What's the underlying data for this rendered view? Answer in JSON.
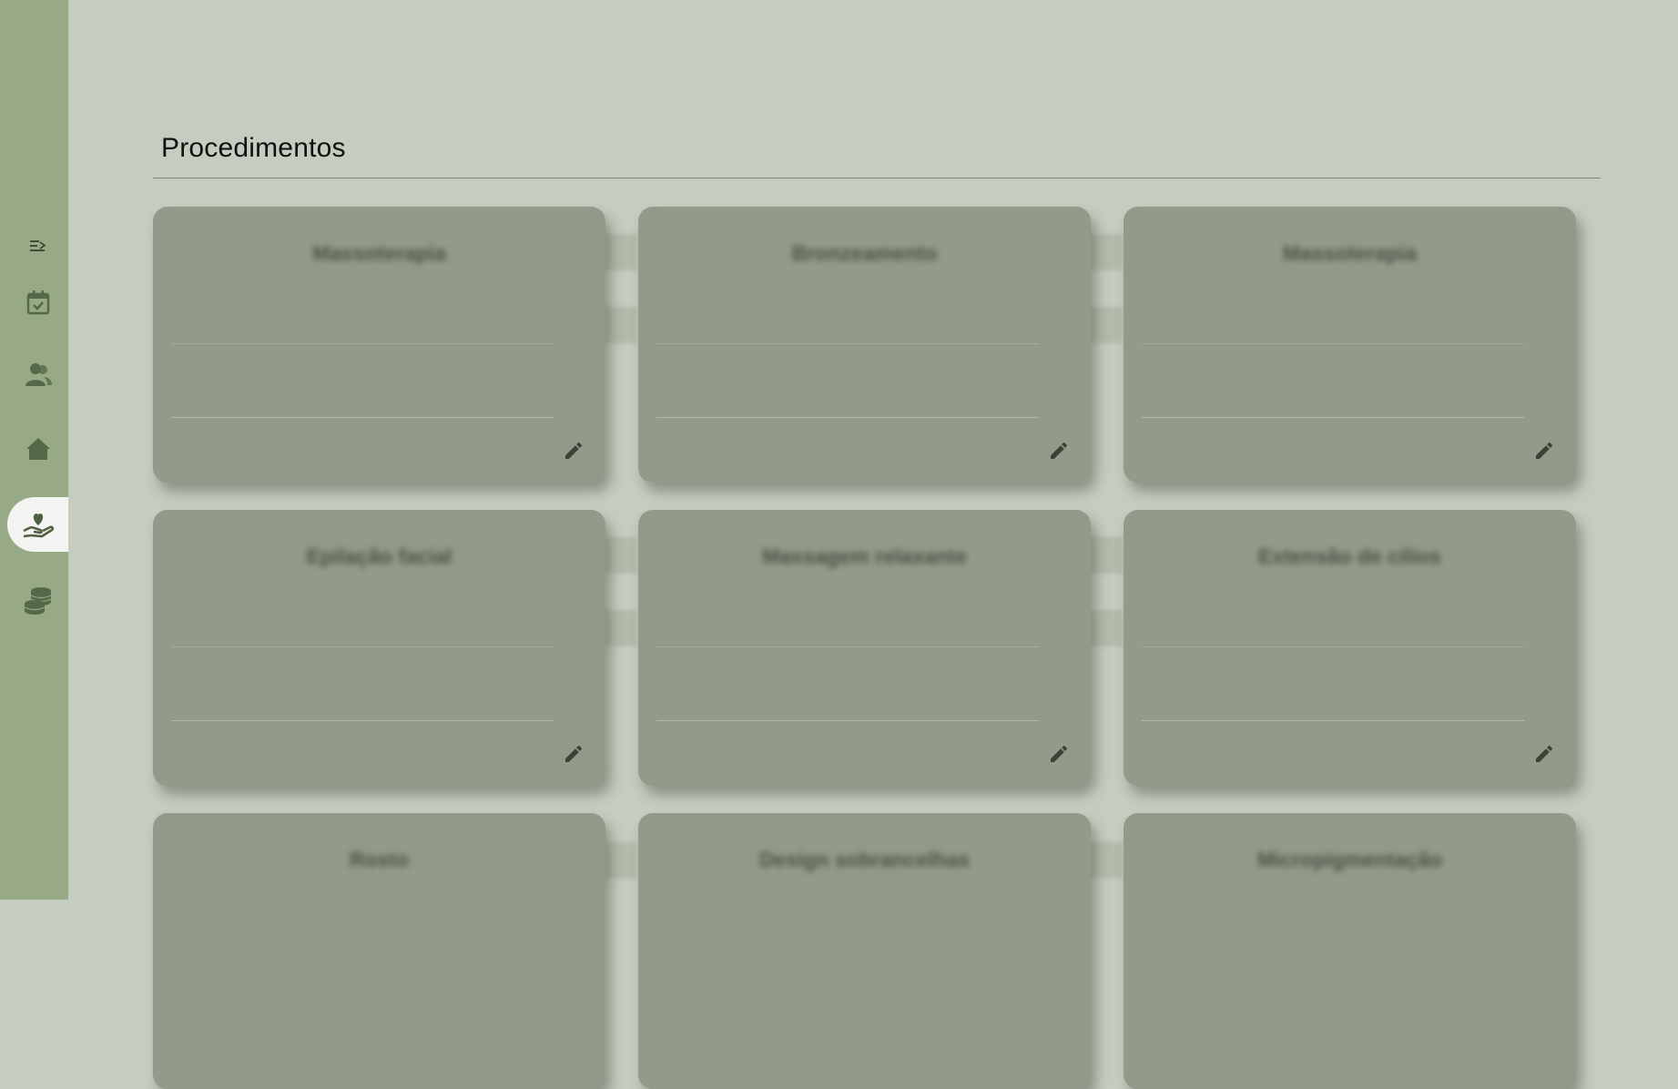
{
  "sidebar": {
    "items": [
      {
        "icon": "menu-collapse-icon",
        "active": false
      },
      {
        "icon": "calendar-check-icon",
        "active": false
      },
      {
        "icon": "users-icon",
        "active": false
      },
      {
        "icon": "home-icon",
        "active": false
      },
      {
        "icon": "hand-heart-icon",
        "active": true
      },
      {
        "icon": "coins-icon",
        "active": false
      }
    ]
  },
  "page": {
    "title": "Procedimentos"
  },
  "cards": [
    {
      "name": "Massoterapia"
    },
    {
      "name": "Bronzeamento"
    },
    {
      "name": "Massoterapia"
    },
    {
      "name": "Epilação facial"
    },
    {
      "name": "Massagem relaxante"
    },
    {
      "name": "Extensão de cílios"
    },
    {
      "name": "Rosto"
    },
    {
      "name": "Design sobrancelhas"
    },
    {
      "name": "Micropigmentação"
    }
  ],
  "colors": {
    "background": "#c5cdc0",
    "sidebar": "#97aa85",
    "card": "#929b8a",
    "icon": "#55694a",
    "active_nav": "#f4f5f2"
  }
}
